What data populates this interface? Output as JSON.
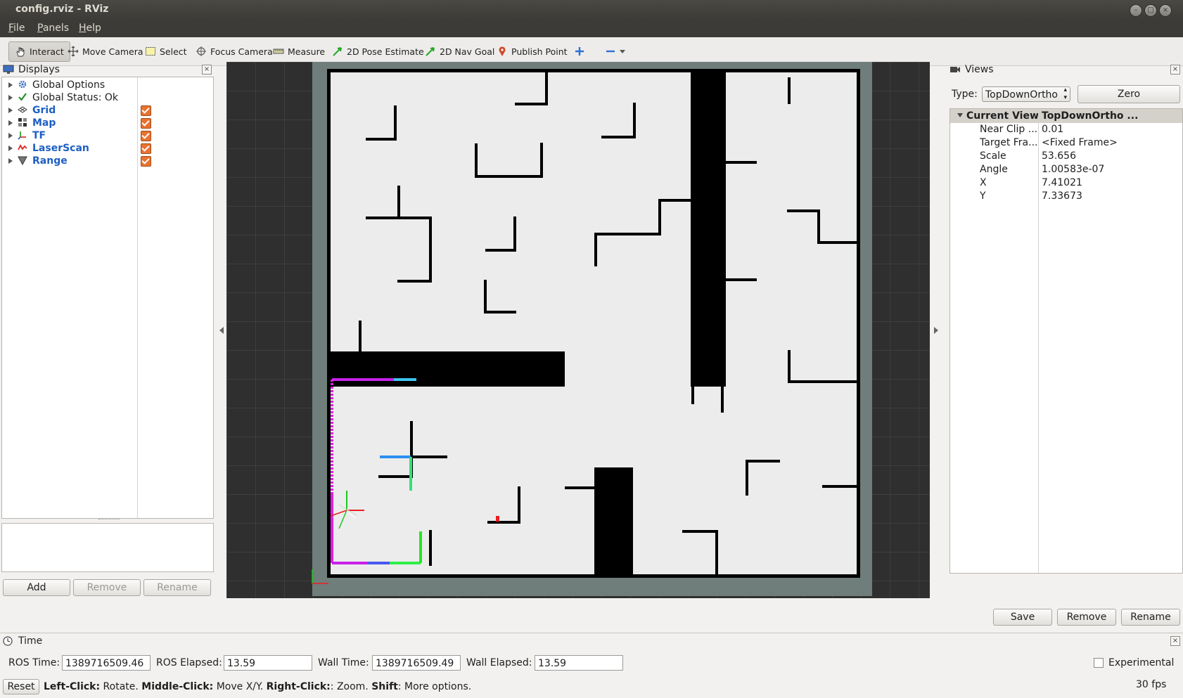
{
  "window": {
    "title": "config.rviz - RViz"
  },
  "menu": [
    {
      "label": "File",
      "mnemonic": "F",
      "rest": "ile"
    },
    {
      "label": "Panels",
      "mnemonic": "P",
      "rest": "anels"
    },
    {
      "label": "Help",
      "mnemonic": "H",
      "rest": "elp"
    }
  ],
  "toolbar": {
    "interact": "Interact",
    "move_camera": "Move Camera",
    "select": "Select",
    "focus_camera": "Focus Camera",
    "measure": "Measure",
    "pose_estimate": "2D Pose Estimate",
    "nav_goal": "2D Nav Goal",
    "publish_point": "Publish Point"
  },
  "displays": {
    "title": "Displays",
    "items": [
      {
        "label": "Global Options",
        "bold": false,
        "color": "#1e1e1e",
        "icon": "gear-icon",
        "checked": null
      },
      {
        "label": "Global Status: Ok",
        "bold": false,
        "color": "#000000",
        "icon": "checkmark-icon",
        "checked": null
      },
      {
        "label": "Grid",
        "bold": true,
        "color": "#1d5fc2",
        "icon": "grid-icon",
        "checked": true
      },
      {
        "label": "Map",
        "bold": true,
        "color": "#1d5fc2",
        "icon": "map-icon",
        "checked": true
      },
      {
        "label": "TF",
        "bold": true,
        "color": "#1d5fc2",
        "icon": "axes-icon",
        "checked": true
      },
      {
        "label": "LaserScan",
        "bold": true,
        "color": "#1d5fc2",
        "icon": "laser-icon",
        "checked": true
      },
      {
        "label": "Range",
        "bold": true,
        "color": "#1d5fc2",
        "icon": "cone-icon",
        "checked": true
      }
    ],
    "add": "Add",
    "remove": "Remove",
    "rename": "Rename"
  },
  "views": {
    "title": "Views",
    "type_label": "Type:",
    "type_value": "TopDownOrtho",
    "zero": "Zero",
    "current_view": "Current View",
    "current_view_value": "TopDownOrtho ...",
    "props": [
      {
        "name": "Near Clip ...",
        "value": "0.01"
      },
      {
        "name": "Target Fra...",
        "value": "<Fixed Frame>"
      },
      {
        "name": "Scale",
        "value": "53.656"
      },
      {
        "name": "Angle",
        "value": "1.00583e-07"
      },
      {
        "name": "X",
        "value": "7.41021"
      },
      {
        "name": "Y",
        "value": "7.33673"
      }
    ],
    "save": "Save",
    "remove": "Remove",
    "rename": "Rename"
  },
  "time": {
    "title": "Time",
    "ros_time_label": "ROS Time:",
    "ros_time": "1389716509.46",
    "ros_elapsed_label": "ROS Elapsed:",
    "ros_elapsed": "13.59",
    "wall_time_label": "Wall Time:",
    "wall_time": "1389716509.49",
    "wall_elapsed_label": "Wall Elapsed:",
    "wall_elapsed": "13.59",
    "experimental": "Experimental"
  },
  "status": {
    "reset": "Reset",
    "left_click": "Left-Click:",
    "left_click_text": " Rotate. ",
    "middle_click": "Middle-Click:",
    "middle_click_text": " Move X/Y. ",
    "right_click": "Right-Click:",
    "right_click_text": ": Zoom. ",
    "shift": "Shift",
    "shift_text": ": More options.",
    "fps": "30 fps"
  }
}
